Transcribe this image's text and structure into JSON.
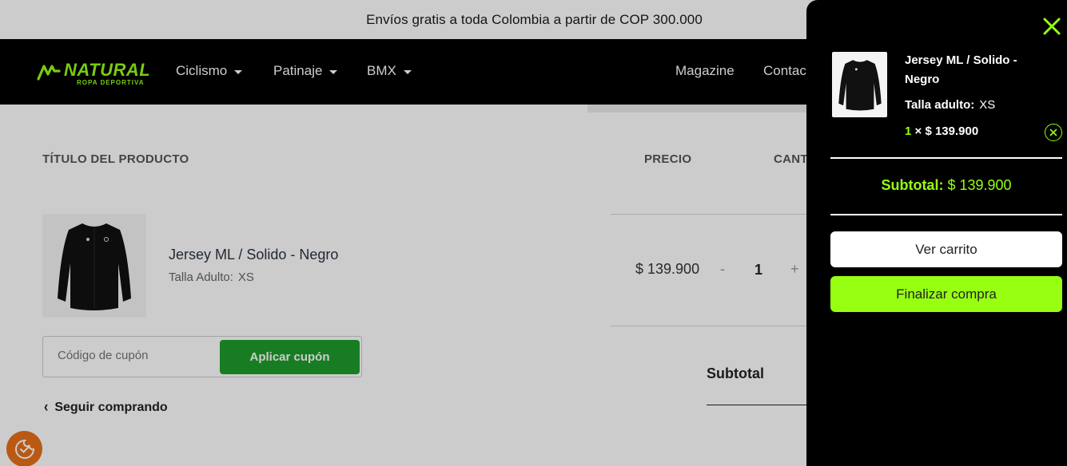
{
  "announcement": "Envíos gratis a toda Colombia a partir de COP 300.000",
  "brand": {
    "name": "NATURAL",
    "tagline": "ROPA DEPORTIVA",
    "accent": "#97ff12"
  },
  "nav": {
    "items": [
      {
        "label": "Ciclismo",
        "has_dropdown": true
      },
      {
        "label": "Patinaje",
        "has_dropdown": true
      },
      {
        "label": "BMX",
        "has_dropdown": true
      },
      {
        "label": "Magazine",
        "has_dropdown": false
      },
      {
        "label": "Contac",
        "has_dropdown": false
      }
    ]
  },
  "cart_table": {
    "headers": {
      "product": "TÍTULO DEL PRODUCTO",
      "price": "PRECIO",
      "quantity": "CANT"
    },
    "item": {
      "name": "Jersey ML / Solido - Negro",
      "attr_label": "Talla Adulto:",
      "attr_value": "XS",
      "price": "$ 139.900",
      "qty_minus": "-",
      "quantity": "1",
      "qty_plus": "+",
      "image_icon": "jersey-icon"
    },
    "coupon": {
      "placeholder": "Código de cupón",
      "button": "Aplicar cupón"
    },
    "continue_label": "Seguir comprando",
    "subtotal_label": "Subtotal"
  },
  "mini_cart": {
    "close_icon": "close-icon",
    "item": {
      "name": "Jersey ML / Solido - Negro",
      "attr_label": "Talla adulto:",
      "attr_value": "XS",
      "qty": "1",
      "times": "×",
      "price": "$ 139.900",
      "remove_icon": "remove-circle-icon"
    },
    "subtotal_label": "Subtotal:",
    "subtotal_value": "$ 139.900",
    "view_cart": "Ver carrito",
    "checkout": "Finalizar compra"
  },
  "cookie_icon": "cookie-settings-icon",
  "colors": {
    "accent": "#97ff12",
    "coupon_button": "#1f9d2b",
    "cookie": "#e8701a"
  }
}
